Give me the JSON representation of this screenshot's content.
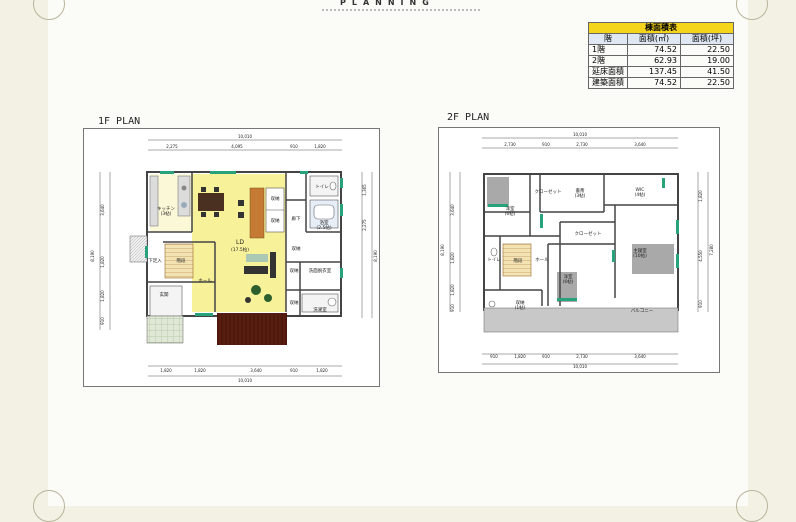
{
  "header": {
    "title": "PLANNING"
  },
  "area_table": {
    "title": "棟面積表",
    "columns": [
      "階",
      "面積(㎡)",
      "面積(坪)"
    ],
    "rows": [
      {
        "floor": "1階",
        "sqm": "74.52",
        "tsubo": "22.50"
      },
      {
        "floor": "2階",
        "sqm": "62.93",
        "tsubo": "19.00"
      },
      {
        "floor": "延床面積",
        "sqm": "137.45",
        "tsubo": "41.50"
      },
      {
        "floor": "建築面積",
        "sqm": "74.52",
        "tsubo": "22.50"
      }
    ]
  },
  "plan1": {
    "title": "1F PLAN",
    "dims": {
      "top_total": "10,010",
      "top": [
        "2,275",
        "4,095",
        "910",
        "1,820"
      ],
      "bottom_total": "10,010",
      "bottom": [
        "1,820",
        "1,820",
        "3,640",
        "910",
        "1,820"
      ],
      "left": [
        "3,640",
        "1,820",
        "1,820",
        "910"
      ],
      "left_total": "8,190",
      "right": [
        "1,365",
        "2,275"
      ],
      "right_total": "8,190"
    },
    "rooms": {
      "kitchen": "キッチン",
      "kitchen_size": "(3帖)",
      "ld": "LD",
      "ld_size": "(17.5帖)",
      "toilet": "トイレ",
      "bath": "浴室",
      "bath_size": "(2.5帖)",
      "corridor": "廊下",
      "storage": "収納",
      "closet1": "収納",
      "closet2": "収納",
      "closet3": "収納",
      "closet4": "収納",
      "washroom": "洗面脱衣室",
      "laundry": "洗濯室",
      "entrance": "玄関",
      "hall": "ホール",
      "shoebox": "下足入",
      "stairs": "階段"
    }
  },
  "plan2": {
    "title": "2F PLAN",
    "dims": {
      "top_total": "10,010",
      "top": [
        "2,730",
        "910",
        "2,730",
        "3,640"
      ],
      "bottom_total": "10,010",
      "bottom": [
        "910",
        "1,820",
        "910",
        "2,730",
        "3,640"
      ],
      "left": [
        "3,640",
        "1,820",
        "1,820",
        "910"
      ],
      "left_total": "8,190",
      "right": [
        "1,820",
        "4,550",
        "910"
      ],
      "right_total": "7,280"
    },
    "rooms": {
      "closet_top": "クローゼット",
      "western1": "洋室",
      "western1_size": "(6帖)",
      "study": "書斎",
      "study_size": "(3帖)",
      "wic": "WIC",
      "wic_size": "(4帖)",
      "closet_mid": "クローゼット",
      "bedroom": "主寝室",
      "bedroom_size": "(10帖)",
      "toilet": "トイレ",
      "hall": "ホール",
      "stairs": "階段",
      "western2": "洋室",
      "western2_size": "(6帖)",
      "storage": "収納",
      "storage_size": "(1帖)",
      "balcony": "バルコニー"
    }
  }
}
